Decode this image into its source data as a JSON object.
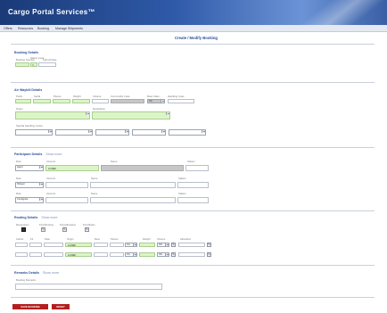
{
  "app": {
    "title": "Cargo Portal Services™"
  },
  "menu": [
    "Offers",
    "Resources",
    "Booking",
    "Manage Shipments"
  ],
  "page": {
    "title": "Create / Modify Booking"
  },
  "colors": {
    "banner": "#2f5aa8",
    "accent": "#2d4f9a",
    "required": "#dcf5c8",
    "readonly": "#c7c7c7",
    "button": "#b31e1e"
  },
  "booking": {
    "heading": "Booking Details",
    "labels": [
      "Booking Number",
      "Status Code",
      "Submit Date"
    ],
    "status_value": "N"
  },
  "shipment": {
    "heading": "Air Waybill Details",
    "row1_labels": [
      "Prefix",
      "Serial",
      "Pieces",
      "Weight",
      "Volume",
      "Commodity Code",
      "Rate Class",
      "Handling Code"
    ],
    "origin_label": "Origin",
    "dest_label": "Destination",
    "special_label": "Special Handling Codes",
    "weight_unit": "KG"
  },
  "participants": {
    "heading": "Participant Details",
    "more": "Show more",
    "col_labels": [
      "Role",
      "Account",
      "Name",
      "Station"
    ],
    "rows": [
      {
        "role": "Agent",
        "account": "LCDEF"
      },
      {
        "role": "Shipper",
        "account": ""
      },
      {
        "role": "Consignee",
        "account": ""
      }
    ]
  },
  "routing": {
    "heading": "Routing Details",
    "more": "Show more",
    "top_labels": [
      "Dimensions",
      "Find Routing",
      "Find Allocation",
      "Find Rates"
    ],
    "col_labels": [
      "Carrier",
      "Flt",
      "Date",
      "Origin",
      "Dest",
      "Pieces",
      "Weight",
      "Volume",
      "Allocation"
    ],
    "rows": [
      {
        "origin": "LCDEF",
        "unit": "KG",
        "status": "NN"
      },
      {
        "origin": "LCDEF",
        "unit": "KG",
        "status": "NN"
      }
    ]
  },
  "remarks": {
    "heading": "Remarks Details",
    "more": "Show more",
    "label": "Booking Remarks"
  },
  "actions": {
    "save": "SAVE BOOKING",
    "reset": "RESET"
  }
}
